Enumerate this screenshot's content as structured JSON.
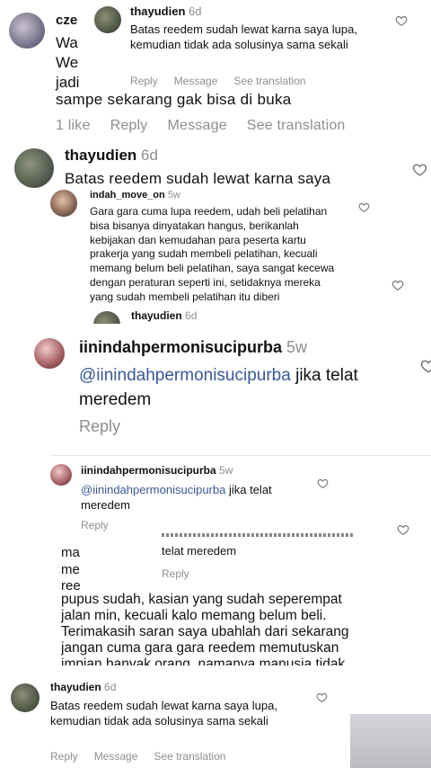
{
  "s1": {
    "back_user": "cze",
    "back_lines": [
      "Wa",
      "We",
      "jadi"
    ],
    "back_tail": "sampe sekarang gak bisa di buka",
    "back_actions": {
      "likes": "1 like",
      "reply": "Reply",
      "message": "Message",
      "translate": "See translation"
    },
    "user": "thayudien",
    "time": "6d",
    "text": "Batas reedem sudah lewat karna saya lupa, kemudian tidak ada solusinya sama sekali",
    "actions": {
      "reply": "Reply",
      "message": "Message",
      "translate": "See translation"
    }
  },
  "s2": {
    "user": "thayudien",
    "time": "6d",
    "text": "Batas reedem sudah lewat karna saya",
    "overlay": {
      "user": "indah_move_on",
      "time": "5w",
      "text": "Gara gara cuma lupa reedem, udah beli pelatihan bisa bisanya dinyatakan hangus, berikanlah kebijakan dan kemudahan para peserta kartu prakerja yang sudah membeli pelatihan, kecuali memang belum beli pelatihan, saya sangat kecewa dengan peraturan seperti ini, setidaknya mereka yang sudah membeli pelatihan itu diberi"
    },
    "peek_user": "thayudien",
    "peek_time": "6d"
  },
  "s3": {
    "user": "iinindahpermonisucipurba",
    "time": "5w",
    "mention": "@iinindahpermonisucipurba",
    "text": " jika telat meredem",
    "reply": "Reply"
  },
  "s4": {
    "user": "iinindahpermonisucipurba",
    "time": "5w",
    "mention": "@iinindahpermonisucipurba",
    "text": " jika telat meredem",
    "reply": "Reply"
  },
  "s5": {
    "left_frag": [
      "ma",
      "me",
      "ree"
    ],
    "right_text": "telat meredem",
    "right_reply": "Reply",
    "main": "pupus sudah, kasian yang sudah seperempat jalan min, kecuali kalo memang belum beli. Terimakasih saran saya ubahlah dari sekarang jangan cuma gara gara reedem memutuskan impian banyak orang, namanya manusia tidak"
  },
  "s6": {
    "user": "thayudien",
    "time": "6d",
    "text": "Batas reedem sudah lewat karna saya lupa, kemudian tidak ada solusinya sama sekali",
    "actions": {
      "reply": "Reply",
      "message": "Message",
      "translate": "See translation"
    }
  }
}
